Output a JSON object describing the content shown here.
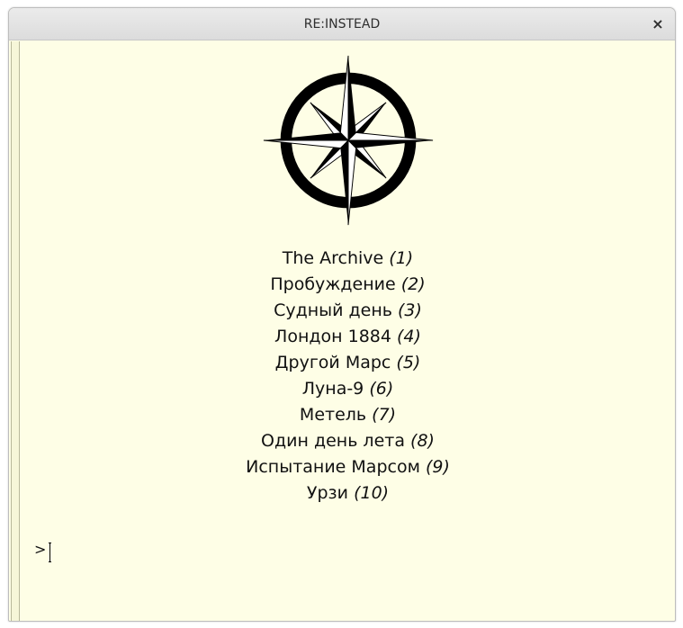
{
  "window": {
    "title": "RE:INSTEAD",
    "close_label": "×"
  },
  "content": {
    "logo_icon": "compass-rose-icon",
    "games": [
      {
        "name": "The Archive",
        "key": "(1)"
      },
      {
        "name": "Пробуждение",
        "key": "(2)"
      },
      {
        "name": "Судный день",
        "key": "(3)"
      },
      {
        "name": "Лондон 1884",
        "key": "(4)"
      },
      {
        "name": "Другой Марс",
        "key": "(5)"
      },
      {
        "name": "Луна-9",
        "key": "(6)"
      },
      {
        "name": "Метель",
        "key": "(7)"
      },
      {
        "name": "Один день лета",
        "key": "(8)"
      },
      {
        "name": "Испытание Марсом",
        "key": "(9)"
      },
      {
        "name": "Урзи",
        "key": "(10)"
      }
    ],
    "prompt": ">"
  },
  "colors": {
    "background": "#fefee6",
    "titlebar": "#e3e3e3",
    "text": "#111111"
  }
}
